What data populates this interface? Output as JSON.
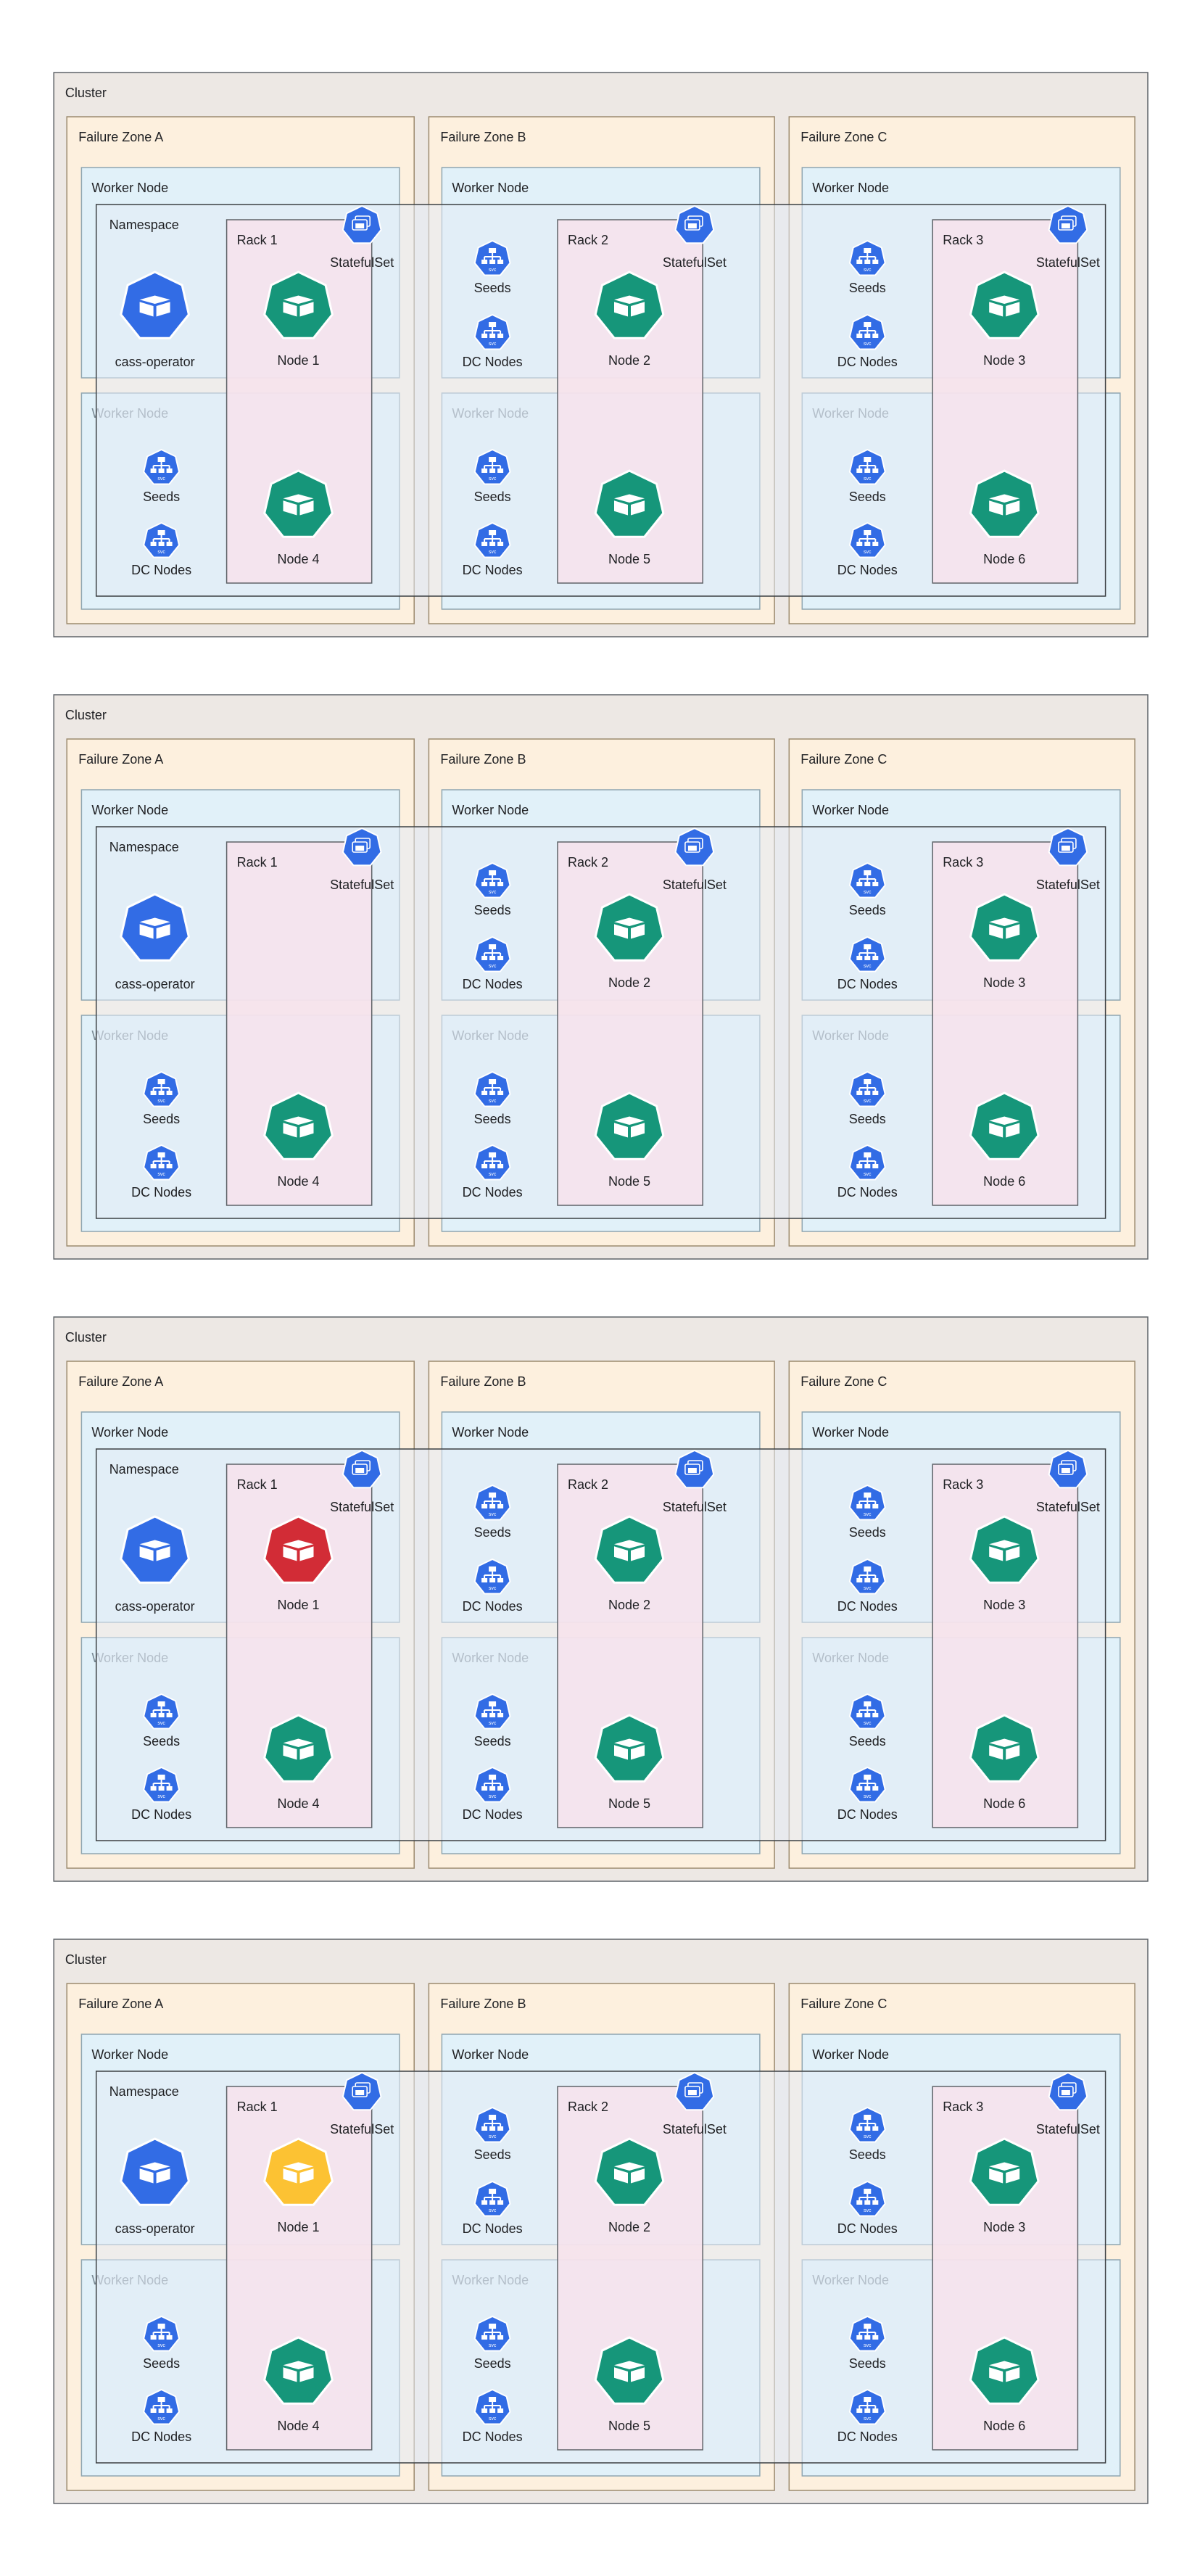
{
  "labels": {
    "cluster": "Cluster",
    "zones": [
      "Failure Zone A",
      "Failure Zone B",
      "Failure Zone C"
    ],
    "worker_node": "Worker Node",
    "namespace": "Namespace",
    "racks": [
      "Rack 1",
      "Rack 2",
      "Rack 3"
    ],
    "statefulset": "StatefulSet",
    "operator": "cass-operator",
    "seeds": "Seeds",
    "dc_nodes": "DC Nodes",
    "svc_badge": "svc"
  },
  "colors": {
    "cluster_fill": "#ede8e4",
    "zone_fill": "#fdf0de",
    "zone_stroke": "#9c8a6e",
    "worker_fill": "#e1f1f9",
    "worker_stroke": "#8fa6b1",
    "namespace_fill": "#e4ebf5",
    "rack_fill": "#f6e2ec",
    "operator": "#326ce5",
    "healthy_node": "#16967a",
    "failed_node": "#d22c36",
    "recovering_node": "#fcc233"
  },
  "diagrams": [
    {
      "node_states": [
        "healthy",
        "healthy",
        "healthy",
        "healthy",
        "healthy",
        "healthy"
      ],
      "node_labels": [
        "Node 1",
        "Node 2",
        "Node 3",
        "Node 4",
        "Node 5",
        "Node 6"
      ]
    },
    {
      "node_states": [
        "missing",
        "healthy",
        "healthy",
        "healthy",
        "healthy",
        "healthy"
      ],
      "node_labels": [
        "",
        "Node 2",
        "Node 3",
        "Node 4",
        "Node 5",
        "Node 6"
      ]
    },
    {
      "node_states": [
        "failed",
        "healthy",
        "healthy",
        "healthy",
        "healthy",
        "healthy"
      ],
      "node_labels": [
        "Node 1",
        "Node 2",
        "Node 3",
        "Node 4",
        "Node 5",
        "Node 6"
      ]
    },
    {
      "node_states": [
        "recovering",
        "healthy",
        "healthy",
        "healthy",
        "healthy",
        "healthy"
      ],
      "node_labels": [
        "Node 1",
        "Node 2",
        "Node 3",
        "Node 4",
        "Node 5",
        "Node 6"
      ]
    }
  ]
}
